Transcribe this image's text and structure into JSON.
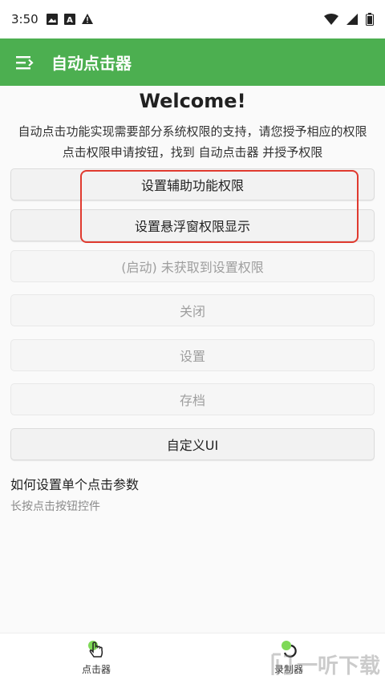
{
  "status_bar": {
    "time": "3:50"
  },
  "app_bar": {
    "title": "自动点击器"
  },
  "welcome": "Welcome!",
  "description": "自动点击功能实现需要部分系统权限的支持，请您授予相应的权限 点击权限申请按钮，找到 自动点击器 并授予权限",
  "buttons": {
    "accessibility": "设置辅助功能权限",
    "overlay": "设置悬浮窗权限显示",
    "start": "(启动) 未获取到设置权限",
    "close": "关闭",
    "settings": "设置",
    "archive": "存档",
    "custom_ui": "自定义UI"
  },
  "howto": {
    "title": "如何设置单个点击参数",
    "desc": "长按点击按钮控件"
  },
  "bottom_nav": {
    "clicker": "点击器",
    "recorder": "录制器"
  },
  "watermark": "一听下载",
  "colors": {
    "accent": "#4caf50",
    "highlight": "#e03a2f"
  }
}
